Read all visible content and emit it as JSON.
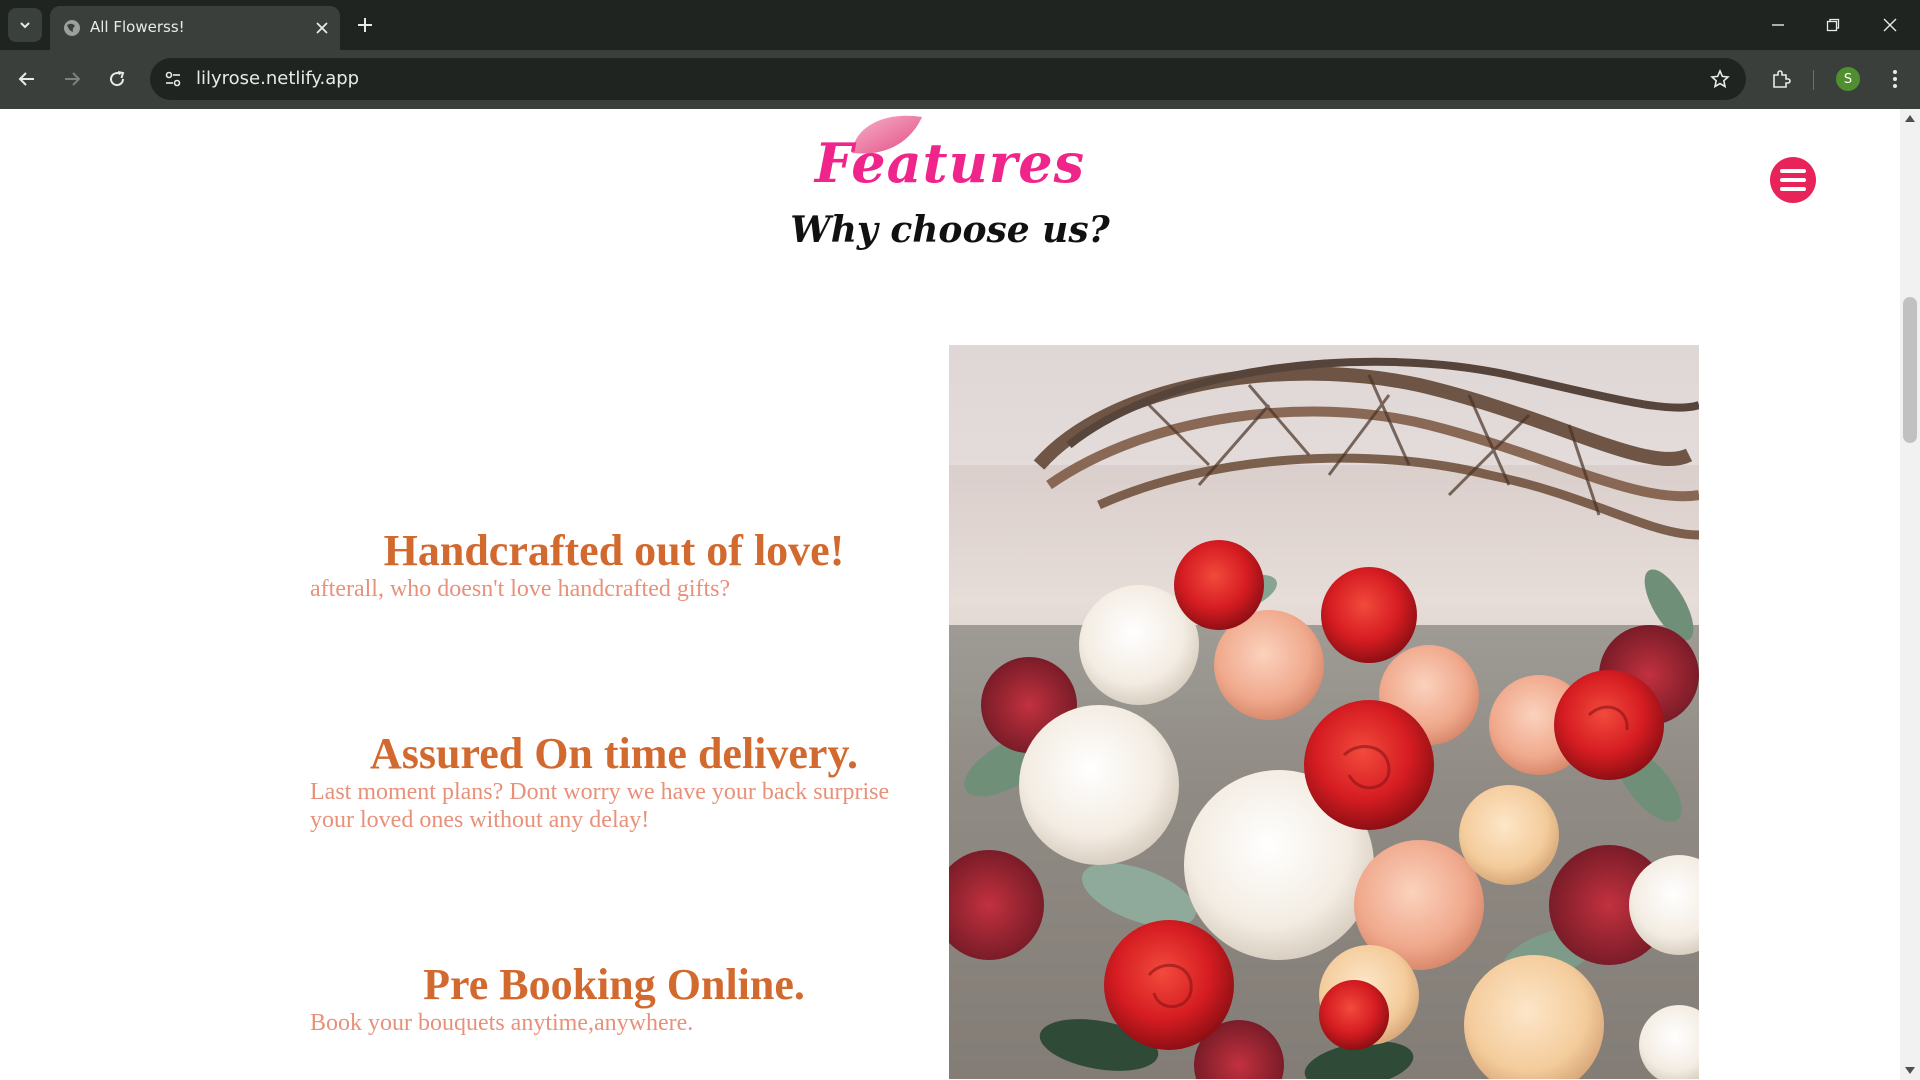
{
  "browser": {
    "tab_title": "All Flowerss!",
    "url": "lilyrose.netlify.app",
    "profile_initial": "S"
  },
  "page": {
    "title": "Features",
    "subtitle": "Why choose us?",
    "features": [
      {
        "heading": "Handcrafted out of love!",
        "text": "afterall, who doesn't love handcrafted gifts?"
      },
      {
        "heading": "Assured On time delivery.",
        "text": "Last moment plans? Dont worry we have your back surprise your loved ones without any delay!"
      },
      {
        "heading": "Pre Booking Online.",
        "text": "Book your bouquets anytime,anywhere."
      }
    ]
  },
  "colors": {
    "accent_pink": "#f0258b",
    "menu_button": "#e8235a",
    "feature_heading": "#d2692f",
    "feature_text": "#e8917a"
  },
  "icons": {
    "menu": "hamburger-menu-icon",
    "back": "arrow-left-icon",
    "forward": "arrow-right-icon",
    "reload": "reload-icon",
    "bookmark": "star-icon",
    "extensions": "puzzle-icon"
  }
}
